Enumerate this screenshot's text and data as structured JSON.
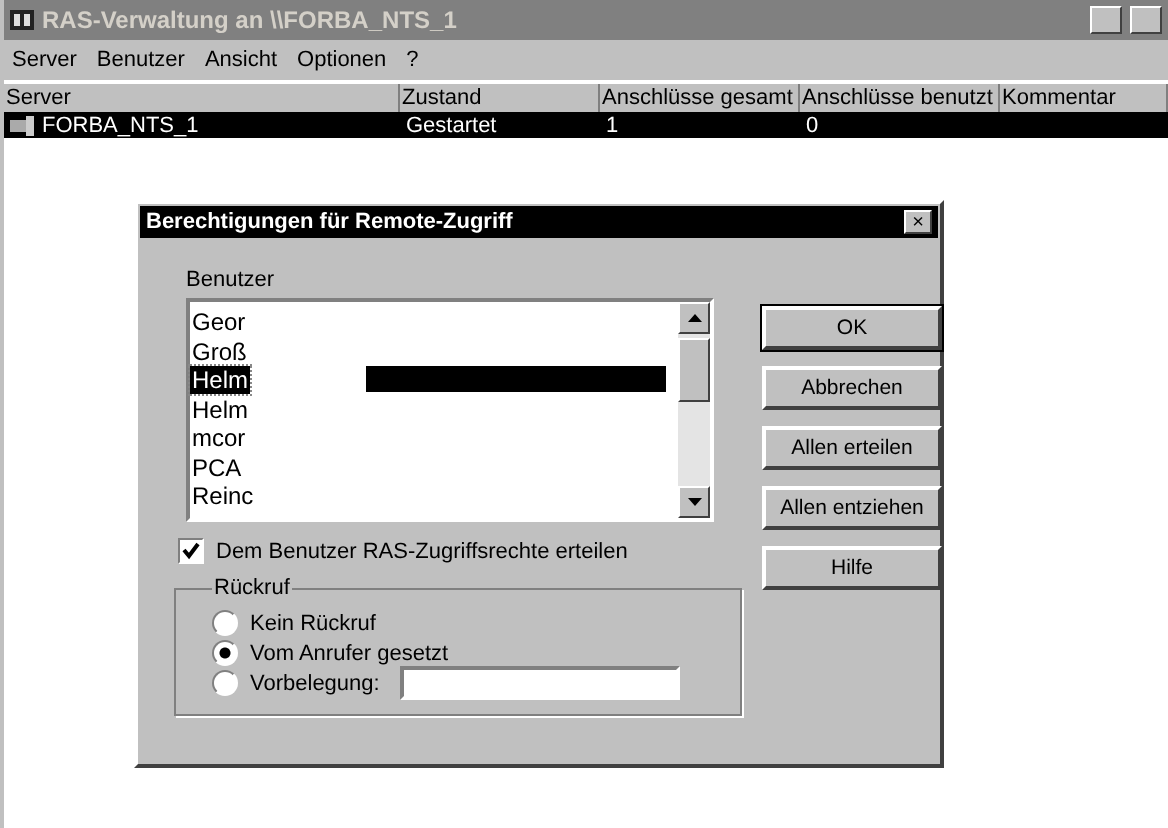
{
  "window": {
    "title": "RAS-Verwaltung an \\\\FORBA_NTS_1"
  },
  "menu": [
    "Server",
    "Benutzer",
    "Ansicht",
    "Optionen",
    "?"
  ],
  "table": {
    "columns": [
      "Server",
      "Zustand",
      "Anschlüsse gesamt",
      "Anschlüsse benutzt",
      "Kommentar"
    ],
    "rows": [
      {
        "cells": [
          "FORBA_NTS_1",
          "Gestartet",
          "1",
          "0",
          ""
        ],
        "selected": true
      }
    ]
  },
  "dialog": {
    "title": "Berechtigungen für Remote-Zugriff",
    "close": "×",
    "users_label": "Benutzer",
    "users": [
      {
        "name": "Geor",
        "selected": false
      },
      {
        "name": "Groß",
        "selected": false
      },
      {
        "name": "Helm",
        "selected": true
      },
      {
        "name": "Helm",
        "selected": false
      },
      {
        "name": "mcor",
        "selected": false
      },
      {
        "name": "PCA",
        "selected": false
      },
      {
        "name": "Reinc",
        "selected": false
      }
    ],
    "grant": {
      "label": "Dem Benutzer RAS-Zugriffsrechte erteilen",
      "checked": true
    },
    "callback": {
      "label": "Rückruf",
      "options": [
        {
          "label": "Kein Rückruf",
          "selected": false
        },
        {
          "label": "Vom Anrufer gesetzt",
          "selected": true
        },
        {
          "label": "Vorbelegung:",
          "selected": false
        }
      ]
    },
    "buttons": [
      "OK",
      "Abbrechen",
      "Allen erteilen",
      "Allen entziehen",
      "Hilfe"
    ]
  }
}
